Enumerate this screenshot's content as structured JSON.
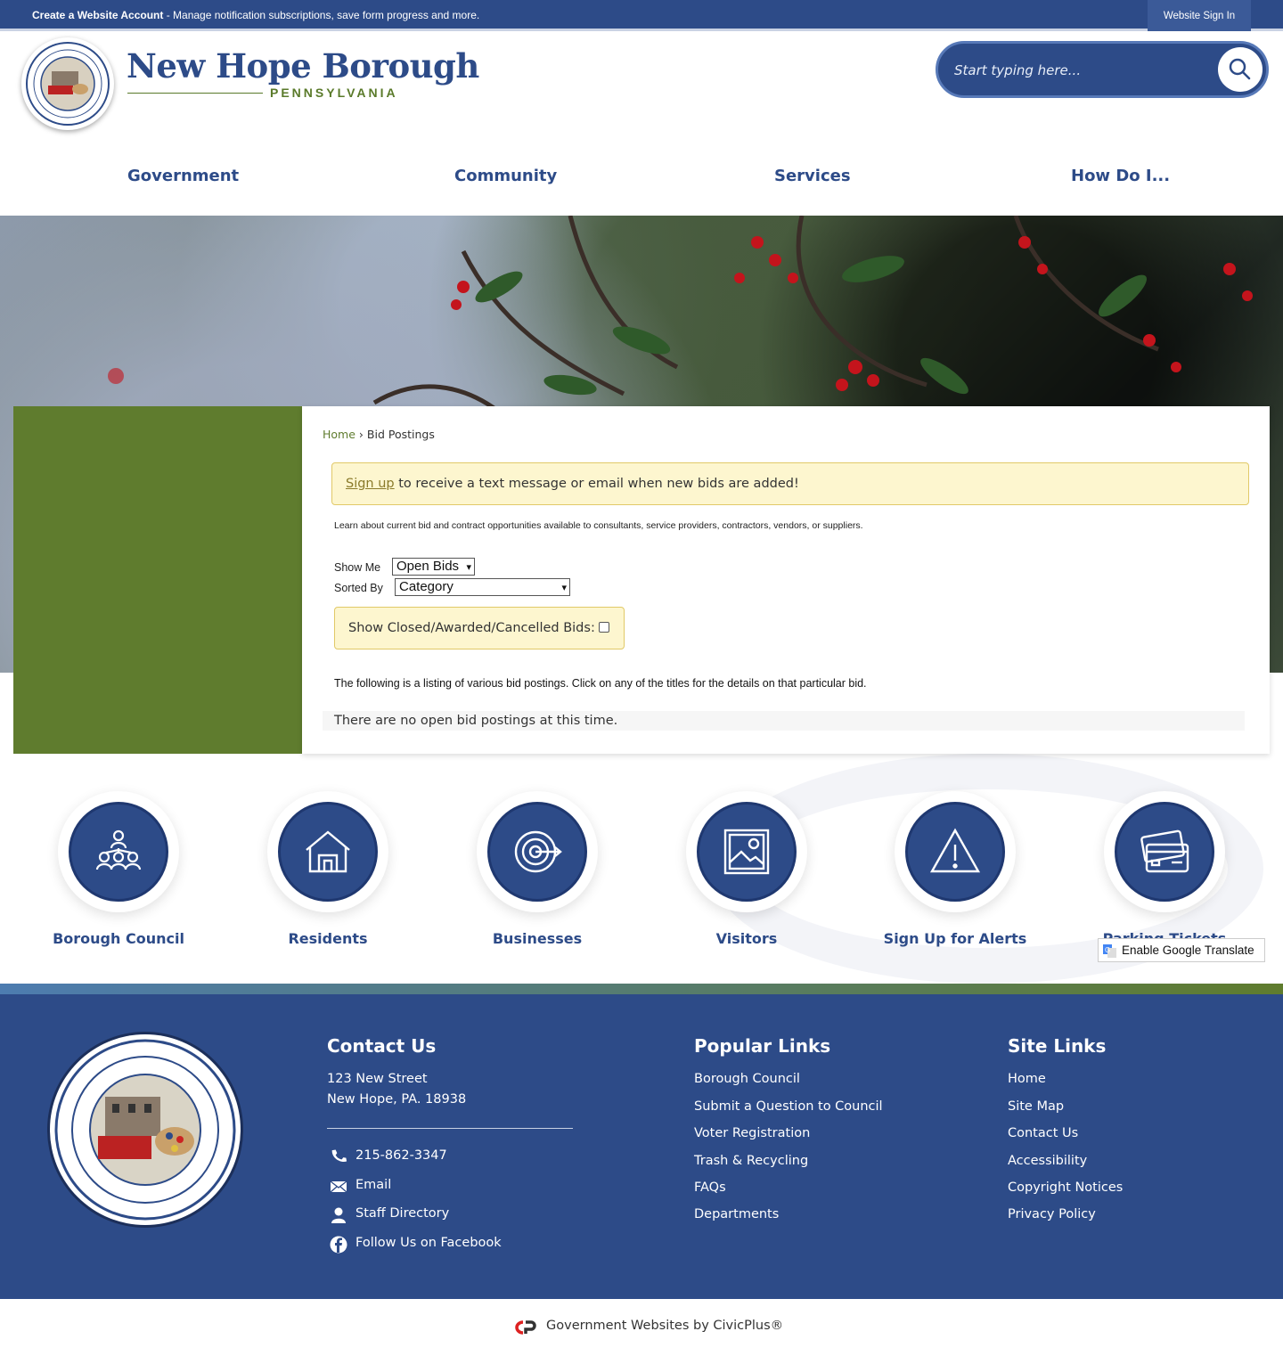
{
  "topbar": {
    "account_bold": "Create a Website Account",
    "account_rest": " - Manage notification subscriptions, save form progress and more.",
    "sign_in": "Website Sign In"
  },
  "header": {
    "title": "New Hope Borough",
    "subtitle": "PENNSYLVANIA",
    "search_placeholder": "Start typing here..."
  },
  "nav": {
    "items": [
      "Government",
      "Community",
      "Services",
      "How Do I..."
    ]
  },
  "breadcrumb": {
    "home": "Home",
    "separator": "›",
    "current": "Bid Postings"
  },
  "alert": {
    "link": "Sign up",
    "text": " to receive a text message or email when new bids are added!"
  },
  "intro": "Learn about current bid and contract opportunities available to consultants, service providers, contractors, vendors, or suppliers.",
  "filters": {
    "show_me_label": "Show Me",
    "show_me_value": "Open Bids",
    "sorted_by_label": "Sorted By",
    "sorted_by_value": "Category",
    "closed_label": "Show Closed/Awarded/Cancelled Bids:"
  },
  "listing_text": "The following is a listing of various bid postings. Click on any of the titles for the details on that particular bid.",
  "no_bids": "There are no open bid postings at this time.",
  "quick_links": [
    {
      "label": "Borough Council",
      "icon": "people-network-icon"
    },
    {
      "label": "Residents",
      "icon": "house-icon"
    },
    {
      "label": "Businesses",
      "icon": "target-icon"
    },
    {
      "label": "Visitors",
      "icon": "picture-icon"
    },
    {
      "label": "Sign Up for Alerts",
      "icon": "warning-icon"
    },
    {
      "label": "Parking Tickets",
      "icon": "credit-card-icon"
    }
  ],
  "translate": "Enable Google Translate",
  "footer": {
    "contact": {
      "heading": "Contact Us",
      "address1": "123 New Street",
      "address2": "New Hope, PA. 18938",
      "phone": "215-862-3347",
      "email": "Email",
      "staff": "Staff Directory",
      "facebook": "Follow Us on Facebook"
    },
    "popular": {
      "heading": "Popular Links",
      "links": [
        "Borough Council",
        "Submit a Question to Council",
        "Voter Registration",
        "Trash & Recycling",
        "FAQs",
        "Departments"
      ]
    },
    "site": {
      "heading": "Site Links",
      "links": [
        "Home",
        "Site Map",
        "Contact Us",
        "Accessibility",
        "Copyright Notices",
        "Privacy Policy"
      ]
    }
  },
  "bottom": {
    "credit": "Government Websites by CivicPlus®"
  },
  "colors": {
    "brand_blue": "#2d4b88",
    "brand_green": "#5f7c2e",
    "alert_bg": "#fdf6cf"
  }
}
